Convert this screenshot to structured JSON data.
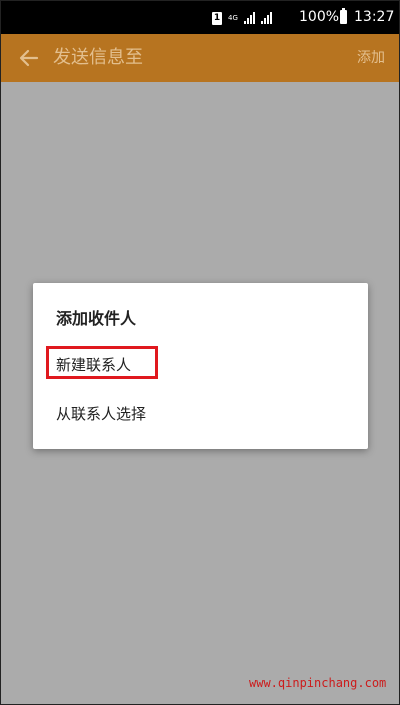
{
  "status_bar": {
    "sim_label": "1",
    "net_label": "4G",
    "battery": "100%",
    "time": "13:27"
  },
  "app_bar": {
    "title": "发送信息至",
    "action": "添加",
    "back_icon": "arrow-left-icon",
    "background": "#b77420",
    "text_color": "#e3bf8e"
  },
  "dialog": {
    "title": "添加收件人",
    "options": [
      {
        "label": "新建联系人",
        "highlighted": true
      },
      {
        "label": "从联系人选择",
        "highlighted": false
      }
    ],
    "highlight_color": "#e0181e"
  },
  "watermark": "www.qinpinchang.com"
}
